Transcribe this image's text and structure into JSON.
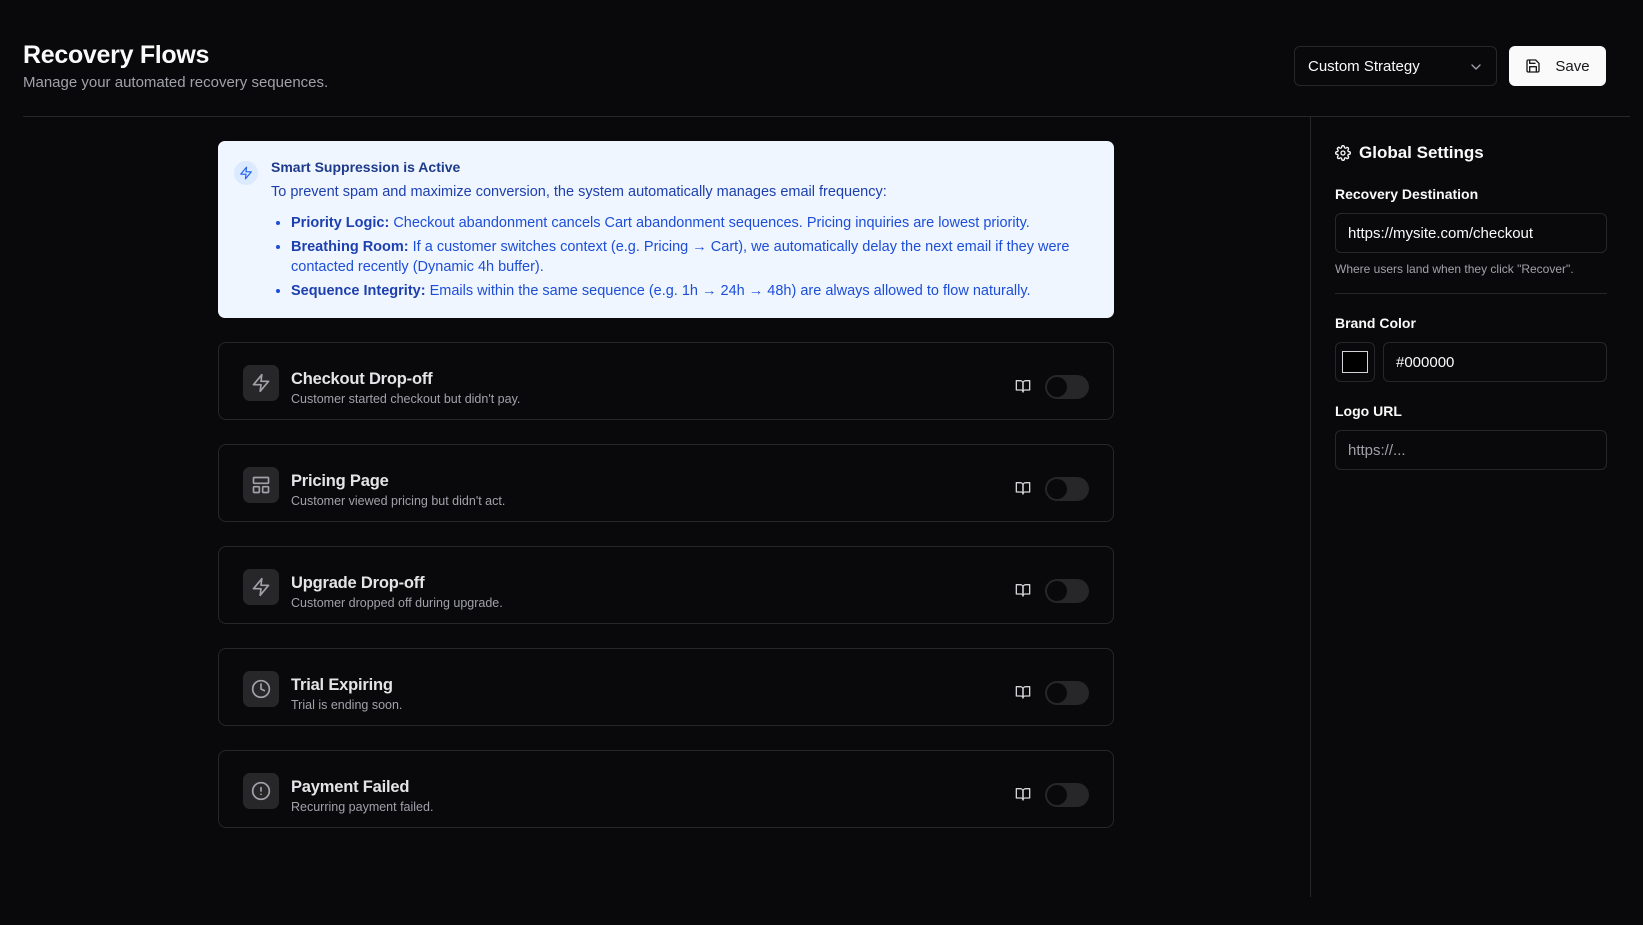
{
  "header": {
    "title": "Recovery Flows",
    "subtitle": "Manage your automated recovery sequences.",
    "strategy_select": "Custom Strategy",
    "save_label": "Save"
  },
  "notice": {
    "title": "Smart Suppression is Active",
    "description": "To prevent spam and maximize conversion, the system automatically manages email frequency:",
    "items": [
      {
        "label": "Priority Logic:",
        "text": "Checkout abandonment cancels Cart abandonment sequences. Pricing inquiries are lowest priority."
      },
      {
        "label": "Breathing Room:",
        "text": "If a customer switches context (e.g. Pricing → Cart), we automatically delay the next email if they were contacted recently (Dynamic 4h buffer)."
      },
      {
        "label": "Sequence Integrity:",
        "text": "Emails within the same sequence (e.g. 1h → 24h → 48h) are always allowed to flow naturally."
      }
    ]
  },
  "flows": [
    {
      "title": "Checkout Drop-off",
      "description": "Customer started checkout but didn't pay.",
      "icon": "zap-icon",
      "enabled": false
    },
    {
      "title": "Pricing Page",
      "description": "Customer viewed pricing but didn't act.",
      "icon": "layout-icon",
      "enabled": false
    },
    {
      "title": "Upgrade Drop-off",
      "description": "Customer dropped off during upgrade.",
      "icon": "zap-icon",
      "enabled": false
    },
    {
      "title": "Trial Expiring",
      "description": "Trial is ending soon.",
      "icon": "clock-icon",
      "enabled": false
    },
    {
      "title": "Payment Failed",
      "description": "Recurring payment failed.",
      "icon": "alert-circle-icon",
      "enabled": false
    }
  ],
  "settings": {
    "title": "Global Settings",
    "recovery_destination_label": "Recovery Destination",
    "recovery_destination_value": "https://mysite.com/checkout",
    "recovery_destination_hint": "Where users land when they click \"Recover\".",
    "brand_color_label": "Brand Color",
    "brand_color_value": "#000000",
    "logo_url_label": "Logo URL",
    "logo_url_placeholder": "https://..."
  },
  "colors": {
    "background": "#09090b",
    "border": "#27272a",
    "notice_bg": "#eff6ff",
    "accent_blue": "#1e40af"
  }
}
